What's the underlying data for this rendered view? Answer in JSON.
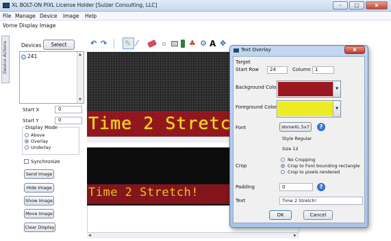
{
  "window": {
    "title": "XL BOLT-ON PIXL  License Holder [Sulzer Consulting, LLC]",
    "minimize_glyph": "–",
    "maximize_glyph": "▢",
    "close_glyph": "x"
  },
  "menu": [
    "File",
    "Manage",
    "Device",
    "Image",
    "Help"
  ],
  "subtitle": "Vorne Display Image",
  "side_tab": "Device Actions",
  "devices": {
    "label": "Devices",
    "select_label": "Select",
    "items": [
      "241"
    ],
    "start_x_label": "Start X",
    "start_x_value": "0",
    "start_y_label": "Start Y",
    "start_y_value": "0"
  },
  "display_mode": {
    "title": "Display Mode",
    "options": [
      "Above",
      "Overlay",
      "Underlay"
    ],
    "selected": "Overlay"
  },
  "synchronize_label": "Synchronize",
  "actions": {
    "send": "Send Image",
    "hide": "Hide Image",
    "show": "Show Image",
    "move": "Move Image",
    "clear": "Clear Display"
  },
  "toolbar": {
    "icons": [
      "undo-icon",
      "redo-icon",
      "pencil-icon",
      "brush-icon",
      "eraser-icon",
      "dot-icon",
      "rectangle-icon",
      "fill-bucket-icon",
      "image-icon",
      "text-a-icon",
      "move-icon"
    ],
    "text_tool_glyph": "A"
  },
  "canvas": {
    "top_text": "Time 2 Stretch!",
    "bottom_text": "Time 2 Stretch!"
  },
  "dialog": {
    "title": "Text Overlay",
    "target_label": "Target",
    "start_row_label": "Start  Row",
    "start_row_value": "24",
    "column_label": "Column",
    "column_value": "1",
    "background_color_label": "Background Color",
    "background_color": "#9b1820",
    "foreground_color_label": "Foreground Color",
    "foreground_color": "#ecea22",
    "font_label": "Font",
    "font_button_label": "VorneXL 5x7",
    "style_text": "Style  Regular",
    "size_text": "Size  12",
    "crop_label": "Crop",
    "crop_options": [
      "No Cropping",
      "Crop to Font bounding rectangle",
      "Crop to pixels rendered"
    ],
    "crop_selected": "Crop to Font bounding rectangle",
    "padding_label": "Padding",
    "padding_value": "0",
    "text_label": "Text",
    "text_value": "Time 2 Stretch!",
    "ok_label": "OK",
    "cancel_label": "Cancel",
    "help_glyph": "?"
  }
}
